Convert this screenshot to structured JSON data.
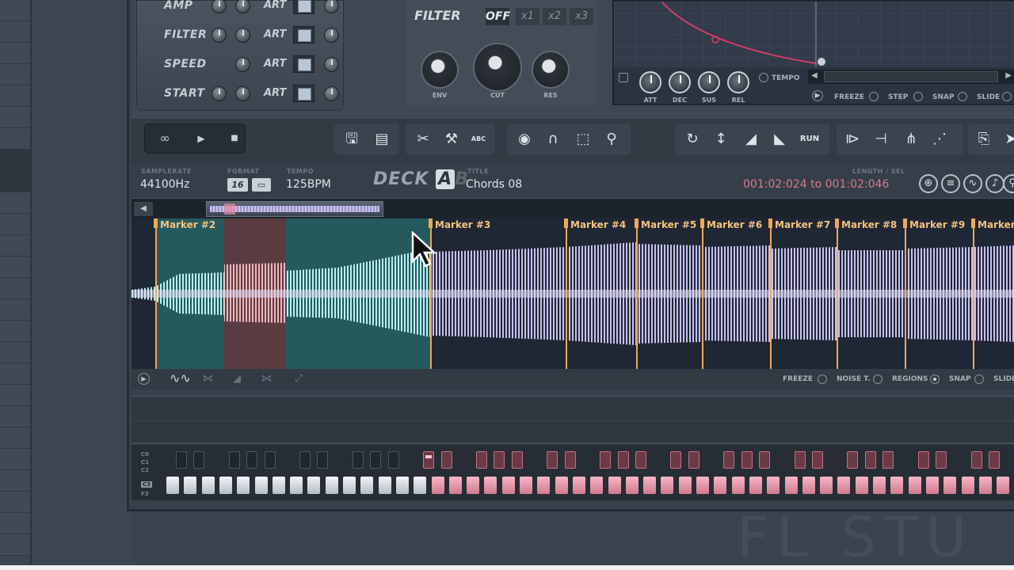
{
  "sampler": {
    "rows": [
      {
        "label": "AMP",
        "art": "ART"
      },
      {
        "label": "FILTER",
        "art": "ART"
      },
      {
        "label": "SPEED",
        "art": "ART"
      },
      {
        "label": "START",
        "art": "ART"
      }
    ]
  },
  "filter": {
    "title": "FILTER",
    "off_label": "OFF",
    "mult": [
      "x1",
      "x2",
      "x3"
    ],
    "knobs": [
      "ENV",
      "CUT",
      "RES"
    ]
  },
  "envelope": {
    "knobs": [
      "ATT",
      "DEC",
      "SUS",
      "REL"
    ],
    "tempo_label": "TEMPO",
    "options": [
      "FREEZE",
      "STEP",
      "SNAP",
      "SLIDE"
    ]
  },
  "toolbar": {
    "run_label": "RUN",
    "abc_label": "ABC"
  },
  "info": {
    "samplerate_label": "SAMPLERATE",
    "samplerate": "44100Hz",
    "format_label": "FORMAT",
    "format_bits": "16",
    "tempo_label": "TEMPO",
    "tempo": "125BPM",
    "deck_label": "DECK",
    "deck_a": "A",
    "deck_b": "B",
    "title_label": "TITLE",
    "title": "Chords 08",
    "length_label": "LENGTH / SEL",
    "selection": "001:02:024 to 001:02:046"
  },
  "markers": [
    "Marker #2",
    "Marker #3",
    "Marker #4",
    "Marker #5",
    "Marker #6",
    "Marker #7",
    "Marker #8",
    "Marker #9",
    "Marker"
  ],
  "wave_options": [
    "FREEZE",
    "NOISE T.",
    "REGIONS",
    "SNAP",
    "SLIDE"
  ],
  "piano": {
    "octaves": [
      "C0",
      "C1",
      "C2",
      "C3",
      "F3"
    ]
  },
  "colors": {
    "selection": "#245a5e",
    "marker": "#f0a857",
    "waveform": "#c8c2ee",
    "selected_wave": "#b8f0f4",
    "highlight": "#e88aa0",
    "envelope_curve": "#d63c66"
  }
}
